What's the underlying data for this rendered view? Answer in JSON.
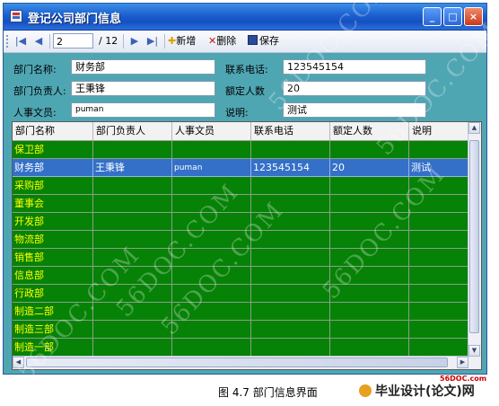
{
  "window": {
    "title": "登记公司部门信息"
  },
  "toolbar": {
    "position": "2",
    "count": "/ 12",
    "add_label": "新增",
    "delete_label": "删除",
    "save_label": "保存"
  },
  "form": {
    "dept_name_label": "部门名称:",
    "dept_name_value": "财务部",
    "phone_label": "联系电话:",
    "phone_value": "123545154",
    "manager_label": "部门负责人:",
    "manager_value": "王秉锋",
    "quota_label": "额定人数",
    "quota_value": "20",
    "hr_label": "人事文员:",
    "hr_value": "puman",
    "desc_label": "说明:",
    "desc_value": "测试"
  },
  "grid": {
    "columns": [
      "部门名称",
      "部门负责人",
      "人事文员",
      "联系电话",
      "额定人数",
      "说明"
    ],
    "rows": [
      [
        "保卫部",
        "",
        "",
        "",
        "",
        ""
      ],
      [
        "财务部",
        "王秉锋",
        "puman",
        "123545154",
        "20",
        "测试"
      ],
      [
        "采购部",
        "",
        "",
        "",
        "",
        ""
      ],
      [
        "董事会",
        "",
        "",
        "",
        "",
        ""
      ],
      [
        "开发部",
        "",
        "",
        "",
        "",
        ""
      ],
      [
        "物流部",
        "",
        "",
        "",
        "",
        ""
      ],
      [
        "销售部",
        "",
        "",
        "",
        "",
        ""
      ],
      [
        "信息部",
        "",
        "",
        "",
        "",
        ""
      ],
      [
        "行政部",
        "",
        "",
        "",
        "",
        ""
      ],
      [
        "制造二部",
        "",
        "",
        "",
        "",
        ""
      ],
      [
        "制造三部",
        "",
        "",
        "",
        "",
        ""
      ],
      [
        "制造一部",
        "",
        "",
        "",
        "",
        ""
      ]
    ],
    "selected_row": 1
  },
  "caption": "图 4.7  部门信息界面",
  "logo": {
    "text": "毕业设计(论文)网",
    "small": "56DOC.com"
  },
  "watermark": "56DOC.COM",
  "colors": {
    "grid_row": "#068206",
    "grid_text": "#ffff00",
    "selected_row": "#3470c8",
    "window_bg": "#4fa6b3"
  }
}
